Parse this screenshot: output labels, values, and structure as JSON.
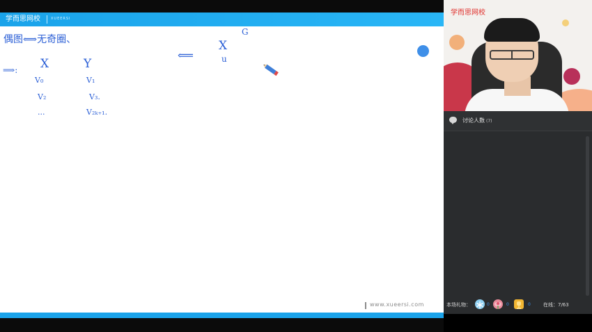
{
  "board": {
    "brand": "学而思网校",
    "brand_sub": "XUEERSI",
    "watermark": "www.xueersi.com",
    "notes": {
      "line1": "偶图⟺无奇圈、",
      "arrow_left": "⟸",
      "imply": "⟹:",
      "col_x": "X",
      "col_y": "Y",
      "v0": "V₀",
      "v2": "V₂",
      "dots": "...",
      "v1": "V₁",
      "v3": "V₃.",
      "v2k1": "V₂ₖ₊₁.",
      "big_x": "X",
      "u": "u",
      "g": "G"
    },
    "accent_color": "#1aa3ea"
  },
  "panel": {
    "video_brand": "学而思网校",
    "discussion": {
      "title": "讨论人数",
      "count": "(7)"
    },
    "gifts": {
      "label": "本场礼物：",
      "items": [
        {
          "icon": "snowflake-icon",
          "count": "0"
        },
        {
          "icon": "flower-icon",
          "count": "0"
        },
        {
          "icon": "trophy-icon",
          "count": "0"
        }
      ]
    },
    "online_label": "在线：",
    "online_value": "7/63"
  }
}
